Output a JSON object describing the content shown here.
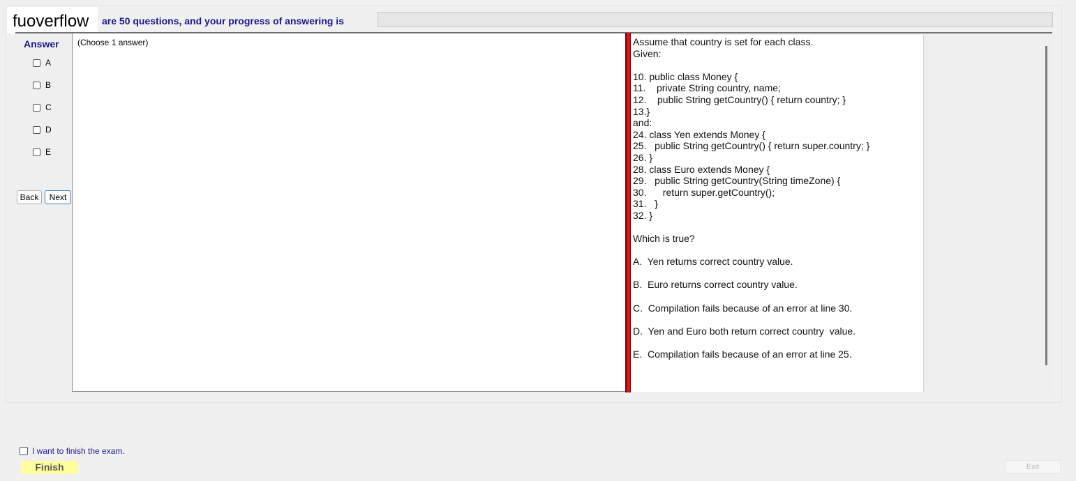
{
  "logo": "fuoverflow",
  "progress_text": "are 50 questions, and your progress of answering is",
  "answer_label": "Answer",
  "options": [
    "A",
    "B",
    "C",
    "D",
    "E"
  ],
  "nav": {
    "back": "Back",
    "next": "Next"
  },
  "choose_hint": "(Choose 1 answer)",
  "question_text": "Assume that country is set for each class.\nGiven:\n\n10. public class Money {\n11.    private String country, name;\n12.    public String getCountry() { return country; }\n13.}\nand:\n24. class Yen extends Money {\n25.   public String getCountry() { return super.country; }\n26. }\n28. class Euro extends Money {\n29.   public String getCountry(String timeZone) {\n30.      return super.getCountry();\n31.   }\n32. }\n\nWhich is true?\n\nA.  Yen returns correct country value.\n\nB.  Euro returns correct country value.\n\nC.  Compilation fails because of an error at line 30.\n\nD.  Yen and Euro both return correct country  value.\n\nE.  Compilation fails because of an error at line 25.",
  "finish_checkbox_label": "I want to finish the exam.",
  "finish_button": "Finish",
  "exit_button": "Exit",
  "colors": {
    "label_blue": "#1a1a8c",
    "splitter_red": "#d11a1a",
    "finish_yellow": "#ffffa0"
  }
}
